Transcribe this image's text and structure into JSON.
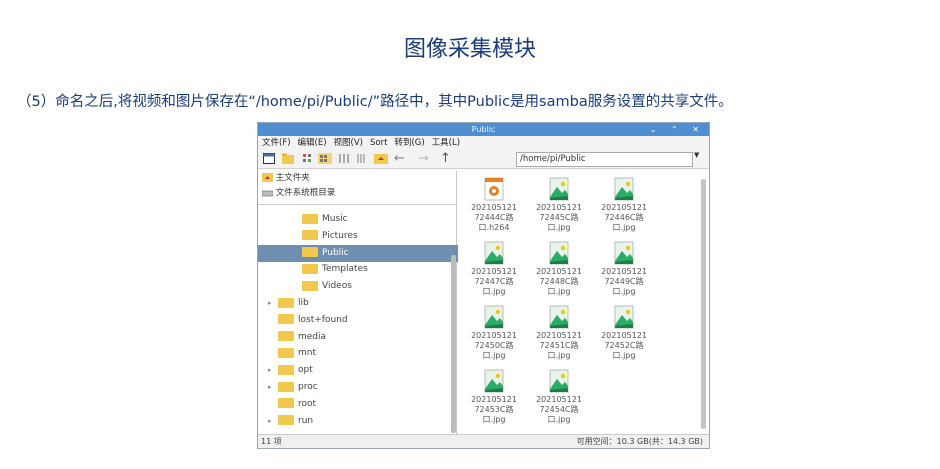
{
  "page": {
    "title": "图像采集模块",
    "paragraph": "（5）命名之后,将视频和图片保存在“/home/pi/Public/”路径中，其中Public是用samba服务设置的共享文件。"
  },
  "file_manager": {
    "window_title": "Public",
    "window_controls": "⌄ ⌃ ✕",
    "menu": [
      "文件(F)",
      "编辑(E)",
      "视图(V)",
      "Sort",
      "转到(G)",
      "工具(L)"
    ],
    "path": "/home/pi/Public",
    "places": [
      "主文件夹",
      "文件系统根目录"
    ],
    "tree": [
      {
        "label": "Music",
        "indent": 2,
        "sel": false,
        "arrow": false
      },
      {
        "label": "Pictures",
        "indent": 2,
        "sel": false,
        "arrow": false
      },
      {
        "label": "Public",
        "indent": 2,
        "sel": true,
        "arrow": false
      },
      {
        "label": "Templates",
        "indent": 2,
        "sel": false,
        "arrow": false
      },
      {
        "label": "Videos",
        "indent": 2,
        "sel": false,
        "arrow": false
      },
      {
        "label": "lib",
        "indent": 1,
        "sel": false,
        "arrow": true
      },
      {
        "label": "lost+found",
        "indent": 1,
        "sel": false,
        "arrow": false
      },
      {
        "label": "media",
        "indent": 1,
        "sel": false,
        "arrow": false
      },
      {
        "label": "mnt",
        "indent": 1,
        "sel": false,
        "arrow": false
      },
      {
        "label": "opt",
        "indent": 1,
        "sel": false,
        "arrow": true
      },
      {
        "label": "proc",
        "indent": 1,
        "sel": false,
        "arrow": true
      },
      {
        "label": "root",
        "indent": 1,
        "sel": false,
        "arrow": false
      },
      {
        "label": "run",
        "indent": 1,
        "sel": false,
        "arrow": true
      }
    ],
    "files": [
      {
        "l1": "202105121",
        "l2": "72444C路",
        "l3": "口.h264",
        "kind": "video"
      },
      {
        "l1": "202105121",
        "l2": "72445C路",
        "l3": "口.jpg",
        "kind": "image"
      },
      {
        "l1": "202105121",
        "l2": "72446C路",
        "l3": "口.jpg",
        "kind": "image"
      },
      {
        "l1": "202105121",
        "l2": "72447C路",
        "l3": "口.jpg",
        "kind": "image"
      },
      {
        "l1": "202105121",
        "l2": "72448C路",
        "l3": "口.jpg",
        "kind": "image"
      },
      {
        "l1": "202105121",
        "l2": "72449C路",
        "l3": "口.jpg",
        "kind": "image"
      },
      {
        "l1": "202105121",
        "l2": "72450C路",
        "l3": "口.jpg",
        "kind": "image"
      },
      {
        "l1": "202105121",
        "l2": "72451C路",
        "l3": "口.jpg",
        "kind": "image"
      },
      {
        "l1": "202105121",
        "l2": "72452C路",
        "l3": "口.jpg",
        "kind": "image"
      },
      {
        "l1": "202105121",
        "l2": "72453C路",
        "l3": "口.jpg",
        "kind": "image"
      },
      {
        "l1": "202105121",
        "l2": "72454C路",
        "l3": "口.jpg",
        "kind": "image"
      }
    ],
    "status_left": "11 项",
    "status_right": "可用空间：10.3 GB(共：14.3 GB)"
  }
}
